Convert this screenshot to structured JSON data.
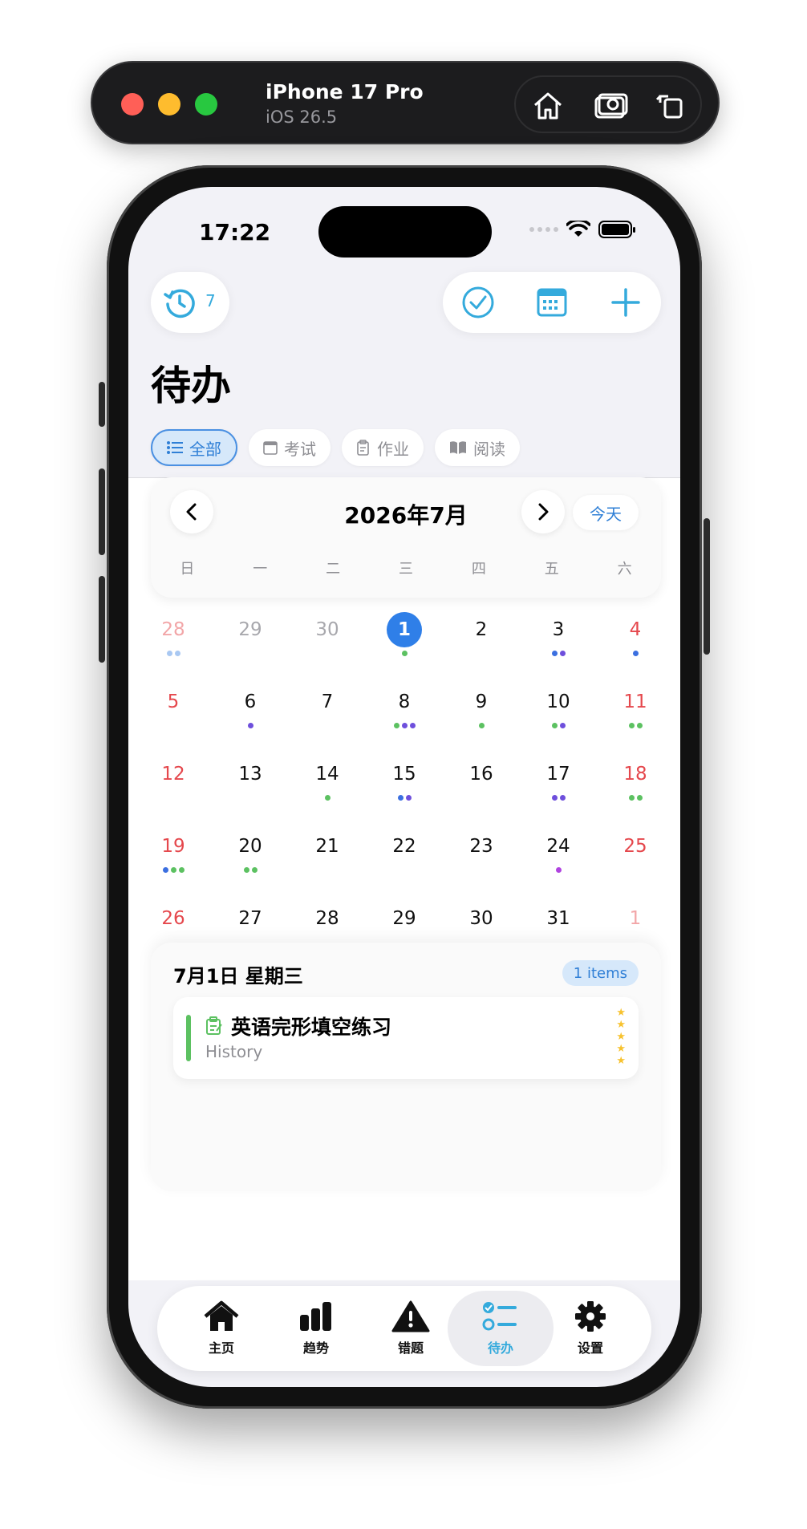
{
  "simulator": {
    "device": "iPhone 17 Pro",
    "os": "iOS 26.5",
    "tools": [
      "home-icon",
      "screenshot-icon",
      "rotate-icon"
    ]
  },
  "status": {
    "time": "17:22"
  },
  "toolbar": {
    "history_count": "7"
  },
  "page": {
    "title": "待办"
  },
  "filters": [
    {
      "label": "全部",
      "icon": "list-icon",
      "active": true
    },
    {
      "label": "考试",
      "icon": "calendar-icon",
      "active": false
    },
    {
      "label": "作业",
      "icon": "clipboard-icon",
      "active": false
    },
    {
      "label": "阅读",
      "icon": "book-icon",
      "active": false
    }
  ],
  "calendar": {
    "month_label": "2026年7月",
    "today_label": "今天",
    "weekdays": [
      "日",
      "一",
      "二",
      "三",
      "四",
      "五",
      "六"
    ],
    "dot_colors": {
      "g": "#5cc161",
      "b": "#3b6fe0",
      "p": "#6e4fdc",
      "lb": "#a9c8f2",
      "m": "#b043e0"
    },
    "weeks": [
      [
        {
          "d": "28",
          "o": true,
          "dots": [
            "lb",
            "lb"
          ]
        },
        {
          "d": "29",
          "o": true,
          "dots": []
        },
        {
          "d": "30",
          "o": true,
          "dots": []
        },
        {
          "d": "1",
          "sel": true,
          "dots": [
            "g"
          ]
        },
        {
          "d": "2",
          "dots": []
        },
        {
          "d": "3",
          "dots": [
            "b",
            "p"
          ]
        },
        {
          "d": "4",
          "dots": [
            "b"
          ]
        }
      ],
      [
        {
          "d": "5",
          "dots": []
        },
        {
          "d": "6",
          "dots": [
            "p"
          ]
        },
        {
          "d": "7",
          "dots": []
        },
        {
          "d": "8",
          "dots": [
            "g",
            "p",
            "p"
          ]
        },
        {
          "d": "9",
          "dots": [
            "g"
          ]
        },
        {
          "d": "10",
          "dots": [
            "g",
            "p"
          ]
        },
        {
          "d": "11",
          "dots": [
            "g",
            "g"
          ]
        }
      ],
      [
        {
          "d": "12",
          "dots": []
        },
        {
          "d": "13",
          "dots": []
        },
        {
          "d": "14",
          "dots": [
            "g"
          ]
        },
        {
          "d": "15",
          "dots": [
            "b",
            "p"
          ]
        },
        {
          "d": "16",
          "dots": []
        },
        {
          "d": "17",
          "dots": [
            "p",
            "p"
          ]
        },
        {
          "d": "18",
          "dots": [
            "g",
            "g"
          ]
        }
      ],
      [
        {
          "d": "19",
          "dots": [
            "b",
            "g",
            "g"
          ]
        },
        {
          "d": "20",
          "dots": [
            "g",
            "g"
          ]
        },
        {
          "d": "21",
          "dots": []
        },
        {
          "d": "22",
          "dots": []
        },
        {
          "d": "23",
          "dots": []
        },
        {
          "d": "24",
          "dots": [
            "m"
          ]
        },
        {
          "d": "25",
          "dots": []
        }
      ],
      [
        {
          "d": "26",
          "dots": []
        },
        {
          "d": "27",
          "dots": []
        },
        {
          "d": "28",
          "dots": []
        },
        {
          "d": "29",
          "dots": []
        },
        {
          "d": "30",
          "dots": []
        },
        {
          "d": "31",
          "dots": []
        },
        {
          "d": "1",
          "o": true,
          "dots": []
        }
      ]
    ]
  },
  "detail": {
    "date_label": "7月1日 星期三",
    "count_badge": "1 items",
    "tasks": [
      {
        "title": "英语完形填空练习",
        "subject": "History",
        "icon": "clipboard-icon",
        "stars": 5
      }
    ]
  },
  "tabs": [
    {
      "label": "主页",
      "icon": "home-icon",
      "active": false
    },
    {
      "label": "趋势",
      "icon": "chart-icon",
      "active": false
    },
    {
      "label": "错题",
      "icon": "warning-icon",
      "active": false
    },
    {
      "label": "待办",
      "icon": "checklist-icon",
      "active": true
    },
    {
      "label": "设置",
      "icon": "gear-icon",
      "active": false
    }
  ]
}
